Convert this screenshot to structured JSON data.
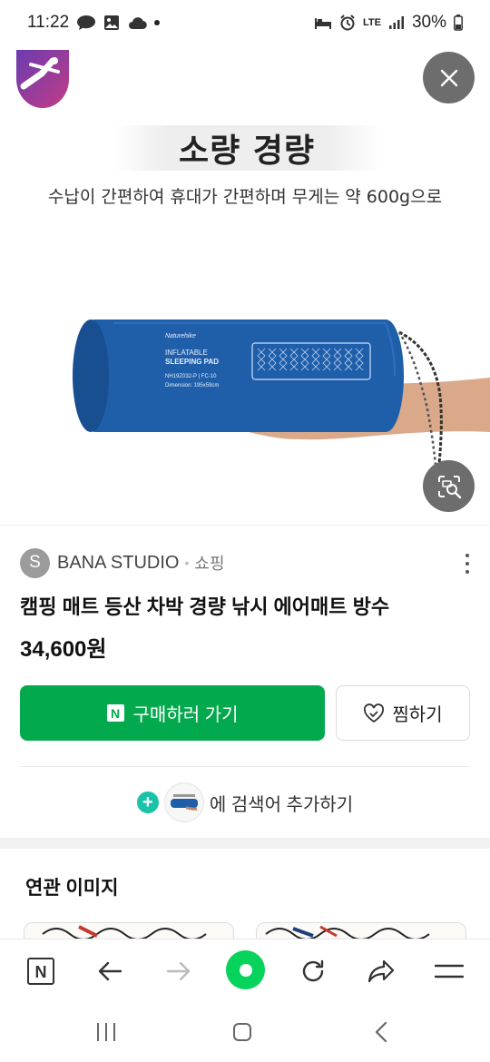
{
  "status_bar": {
    "time": "11:22",
    "battery": "30%",
    "network": "LTE"
  },
  "promo": {
    "title": "소량 경량",
    "subtitle": "수납이 간편하여 휴대가 간편하며 무게는 약 600g으로",
    "bag_brand": "Naturehike",
    "bag_line1": "INFLATABLE",
    "bag_line2": "SLEEPING PAD",
    "bag_model": "NH19Z032-P | FC-10",
    "bag_dimension": "Dimension: 195x59cm"
  },
  "seller": {
    "avatar_letter": "S",
    "name": "BANA STUDIO",
    "separator": "•",
    "category": "쇼핑"
  },
  "product": {
    "title": "캠핑 매트 등산 차박 경량 낚시 에어매트 방수",
    "price": "34,600원"
  },
  "actions": {
    "buy_badge": "N",
    "buy_label": "구매하러 가기",
    "zzim_label": "찜하기",
    "add_search_label": "에 검색어 추가하기"
  },
  "related": {
    "title": "연관 이미지"
  },
  "browser_bar": {
    "n_label": "N"
  },
  "colors": {
    "buy_green": "#03a94d",
    "home_green": "#06d35b",
    "add_teal": "#19c4a6",
    "bag_blue": "#1f5ea8"
  }
}
